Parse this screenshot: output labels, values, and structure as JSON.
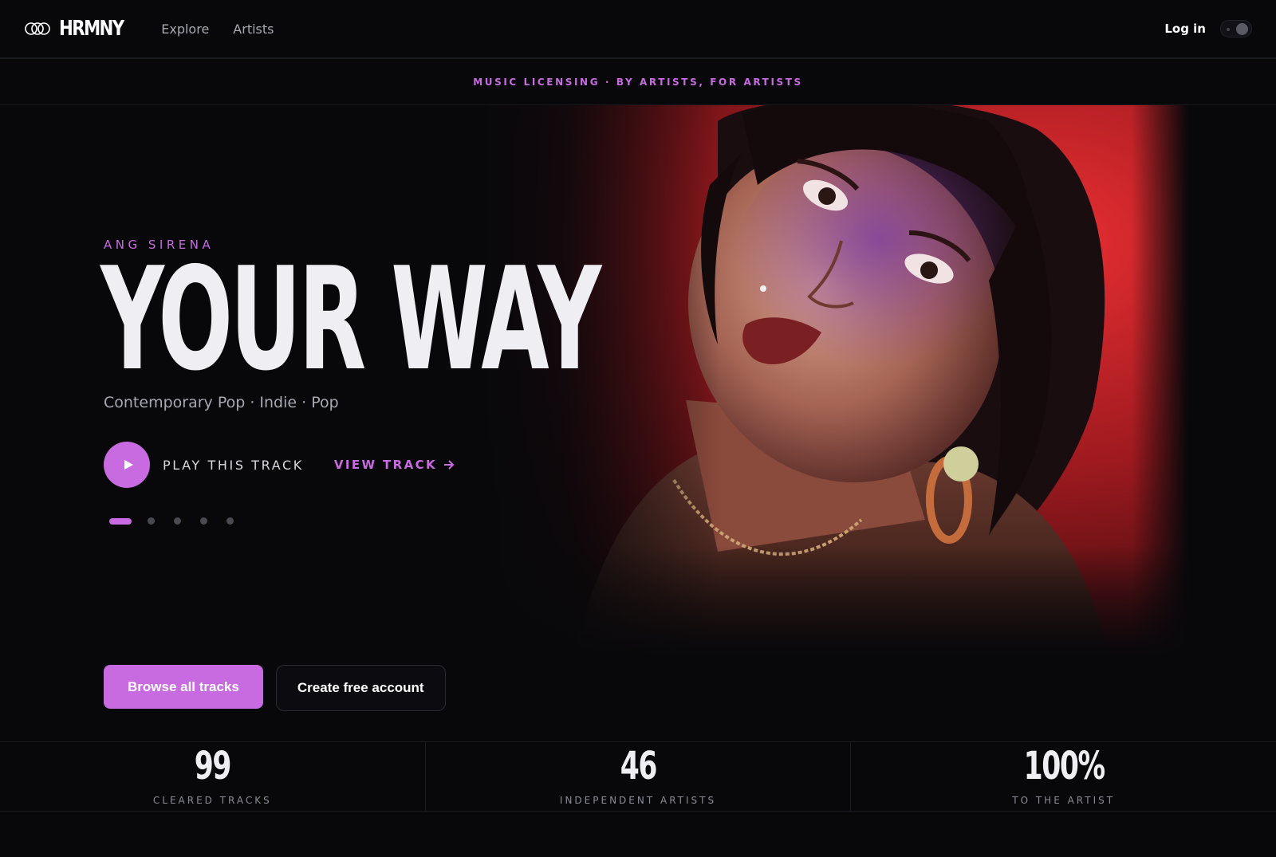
{
  "brand": {
    "name": "HRMNY",
    "logo_icon": "three-rings-icon"
  },
  "nav": {
    "links": [
      {
        "label": "Explore"
      },
      {
        "label": "Artists"
      }
    ],
    "login_label": "Log in",
    "theme_toggle_icon": "theme-toggle"
  },
  "tagline": "MUSIC LICENSING · BY ARTISTS, FOR ARTISTS",
  "hero": {
    "artist": "ANG SIRENA",
    "title": "YOUR WAY",
    "genres": "Contemporary Pop · Indie · Pop",
    "play_label": "PLAY THIS TRACK",
    "view_track_label": "VIEW TRACK",
    "view_track_icon": "arrow-right-icon",
    "slides_total": 5,
    "active_slide": 1,
    "photo_description_icon": "artist-portrait-image"
  },
  "cta": {
    "primary": "Browse all tracks",
    "secondary": "Create free account"
  },
  "stats": [
    {
      "value": "99",
      "label": "CLEARED TRACKS"
    },
    {
      "value": "46",
      "label": "INDEPENDENT ARTISTS"
    },
    {
      "value": "100%",
      "label": "TO THE ARTIST"
    }
  ],
  "colors": {
    "accent": "#c86ae0",
    "background": "#08080b",
    "text": "#efeff3",
    "muted": "#a8a8b2",
    "photo_backdrop_red": "#d8262a"
  }
}
